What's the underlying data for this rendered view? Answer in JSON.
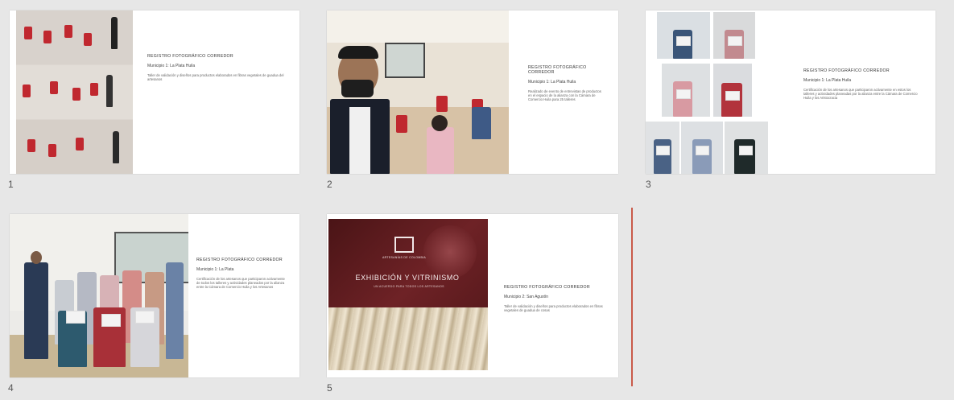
{
  "slides": [
    {
      "number": "1",
      "title": "REGISTRO FOTOGRÁFICO CORREDOR",
      "municipality": "Municipio 1: La Plata Huila",
      "description": "Taller de validación y diseños para productos elaborados en fibras vegetales de guadua del artesanos"
    },
    {
      "number": "2",
      "title": "REGISTRO FOTOGRÁFICO CORREDOR",
      "municipality": "Municipio 1: La Plata Huila",
      "description": "Realizado de evento de entrevistas de productos en el espacio de la alianza con la Cámara de Comercio Huila para 25 talleres"
    },
    {
      "number": "3",
      "title": "REGISTRO FOTOGRÁFICO CORREDOR",
      "municipality": "Municipio 1: La Plata Huila",
      "description": "Certificación de los artesanos que participaron activamente en estos los talleres y actividades planeadas por la alianza entre la Cámara de Comercio Huila y los Aristocracia"
    },
    {
      "number": "4",
      "title": "REGISTRO FOTOGRÁFICO CORREDOR",
      "municipality": "Municipio 1: La Plata",
      "description": "Certificación de los artesanos que participaron activamente de todos los talleres y actividades planeados por la alianza entre la Cámara de Comercio Huila y los Artesanos"
    },
    {
      "number": "5",
      "title": "REGISTRO FOTOGRÁFICO CORREDOR",
      "municipality": "Municipio 2: San Agustín",
      "description": "Taller de validación y diseños para productos elaborados en fibras vegetales de guadua de cosas",
      "cover_title": "EXHIBICIÓN Y VITRINISMO",
      "cover_brand": "ARTESANÍAS DE COLOMBIA",
      "cover_subtitle": "UN ACUERDO PARA TODOS LOS ARTESANOS"
    }
  ],
  "colors": {
    "background": "#e7e7e7",
    "slide": "#ffffff",
    "accent_red": "#c0282f",
    "cover_dark_red": "#5c1a1d",
    "drag_indicator": "#c95a4a"
  }
}
